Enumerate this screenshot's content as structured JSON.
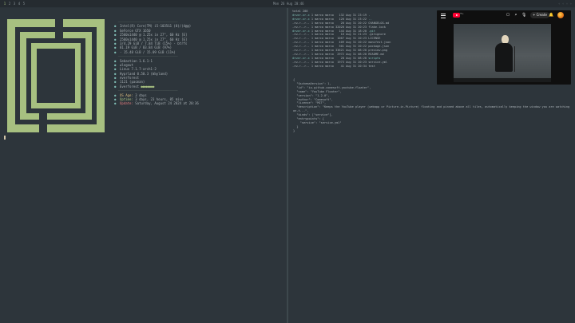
{
  "topbar": {
    "workspaces": [
      "1",
      "2",
      "3",
      "4",
      "5"
    ],
    "active_workspace": "1",
    "clock": "Mon 26 Aug 20:46",
    "system": "◦ ◦ ◦ ◦"
  },
  "sysinfo": [
    {
      "icon": "",
      "text": "Intel(R) Core(TM) i5-1035G1 (8)/(4@@)",
      "cls": "c-b"
    },
    {
      "icon": "",
      "text": "GeForce GTX 1650",
      "cls": "c-g"
    },
    {
      "icon": "",
      "text": "2560x1440 @ 1.25x in 27\", 60 Hz [E]",
      "cls": "c-y"
    },
    {
      "icon": "",
      "text": "2560x1440 @ 1.25x in 27\", 60 Hz [E]",
      "cls": "c-y"
    },
    {
      "icon": "",
      "text": "3/4.29 GiB / 7.84 TiB (15%) - btrfs",
      "cls": "c-p"
    },
    {
      "icon": "",
      "text": "81.19 GiB / 83.84 GiB (97%)",
      "cls": "c-r"
    },
    {
      "icon": "",
      "text": "- 15.48 GiB / 15.09 GiB (11%)",
      "cls": "c-b"
    }
  ],
  "osinfo": [
    {
      "icon": "",
      "text": "Sebastian 1.6.1-1",
      "cls": "c-b"
    },
    {
      "icon": "",
      "text": "wlogout",
      "cls": "c-g"
    },
    {
      "icon": "",
      "text": "Linux 7.1.7-arch1-2",
      "cls": "c-y"
    },
    {
      "icon": "",
      "text": "Hyprland 0.50.3 (Wayland)",
      "cls": "c-p"
    },
    {
      "icon": "",
      "text": "everforest",
      "cls": "c-r"
    },
    {
      "icon": "",
      "text": "1121 (pacman)",
      "cls": "c-b"
    },
    {
      "icon": "",
      "text": "Everforest",
      "cls": "c-g",
      "dots": "●●●●●●●●"
    }
  ],
  "uptime": [
    {
      "icon": "",
      "label": "OS Age:",
      "text": "3 days",
      "cls": "c-y"
    },
    {
      "icon": "",
      "label": "Uptime:",
      "text": "3 days, 23 hours, 05 mins",
      "cls": "c-g"
    },
    {
      "icon": "",
      "label": "Update:",
      "text": "Saturday, August 24 2024 at 20:36",
      "cls": "c-r"
    }
  ],
  "listing": {
    "header": "total 200",
    "rows": [
      {
        "perm": "drwxr-xr-x",
        "user": "1 marco marco",
        "size": "132",
        "date": "Aug 31 23:19",
        "name": ".",
        "dir": true
      },
      {
        "perm": "drwxr-xr-x",
        "user": "1 marco marco",
        "size": "120",
        "date": "Aug 31 23:22",
        "name": "..",
        "dir": true
      },
      {
        "perm": "-rw-r--r--",
        "user": "1 marco marco",
        "size": "20",
        "date": "Aug 31 20:22",
        "name": "CHANGELOG.md",
        "dir": false
      },
      {
        "perm": "-rw-r--r--",
        "user": "1 marco marco",
        "size": "32020",
        "date": "Aug 31 20:23",
        "name": "flake.lock",
        "dir": false
      },
      {
        "perm": "drwxr-xr-x",
        "user": "1 marco marco",
        "size": "144",
        "date": "Aug 31 18:20",
        "name": ".git",
        "dir": true
      },
      {
        "perm": "-rw-r--r--",
        "user": "1 marco marco",
        "size": "16",
        "date": "Aug 31 21:23",
        "name": ".gitignore",
        "dir": false
      },
      {
        "perm": "-rw-r--r--",
        "user": "1 marco marco",
        "size": "1067",
        "date": "Aug 31 20:23",
        "name": "LICENSE",
        "dir": false
      },
      {
        "perm": "-rw-r--r--",
        "user": "1 marco marco",
        "size": "409",
        "date": "Aug 31 20:22",
        "name": "manifest.json",
        "dir": false
      },
      {
        "perm": "-rw-r--r--",
        "user": "1 marco marco",
        "size": "301",
        "date": "Aug 31 20:22",
        "name": "package.json",
        "dir": false
      },
      {
        "perm": "-rw-r--r--",
        "user": "1 marco marco",
        "size": "33621",
        "date": "Aug 31 08:20",
        "name": "preview.png",
        "dir": false
      },
      {
        "perm": "-rw-r--r--",
        "user": "1 marco marco",
        "size": "2972",
        "date": "Aug 31 08:20",
        "name": "README.md",
        "dir": false
      },
      {
        "perm": "drwxr-xr-x",
        "user": "1 marco marco",
        "size": "28",
        "date": "Aug 31 08:20",
        "name": "scripts",
        "dir": true
      },
      {
        "perm": "-rw-r--r--",
        "user": "1 marco marco",
        "size": "1973",
        "date": "Aug 31 20:23",
        "name": "service.yml",
        "dir": false
      },
      {
        "perm": "-rw-r--r--",
        "user": "1 marco marco",
        "size": "41",
        "date": "Aug 31 20:34",
        "name": "test",
        "dir": false
      }
    ]
  },
  "json_text": [
    "{",
    "  \"$schemaVersion\": 1,",
    "  \"id\": \"io.github.comesoft.youtube-floater\",",
    "  \"name\": \"YouTube Floater\",",
    "  \"version\": \"1.2.0\",",
    "  \"author\": \"Comesoft\",",
    "  \"license\": \"MIT\",",
    "  \"description\": \"Keeps the YouTube player (webapp or Picture-in-Picture) floating and pinned above all tiles, automatically keeping the window you are watching on-t...\",",
    "  \"kinds\": [\"service\"],",
    "  \"entrypoints\": {",
    "    \"service\": \"service.yml\"",
    "  }",
    "}",
    ""
  ],
  "youtube": {
    "create_label": "Create",
    "badge": "⁹⁺",
    "icons": {
      "cast": "cast-icon",
      "search": "search-icon",
      "mic": "mic-icon",
      "bell": "bell-icon"
    }
  }
}
